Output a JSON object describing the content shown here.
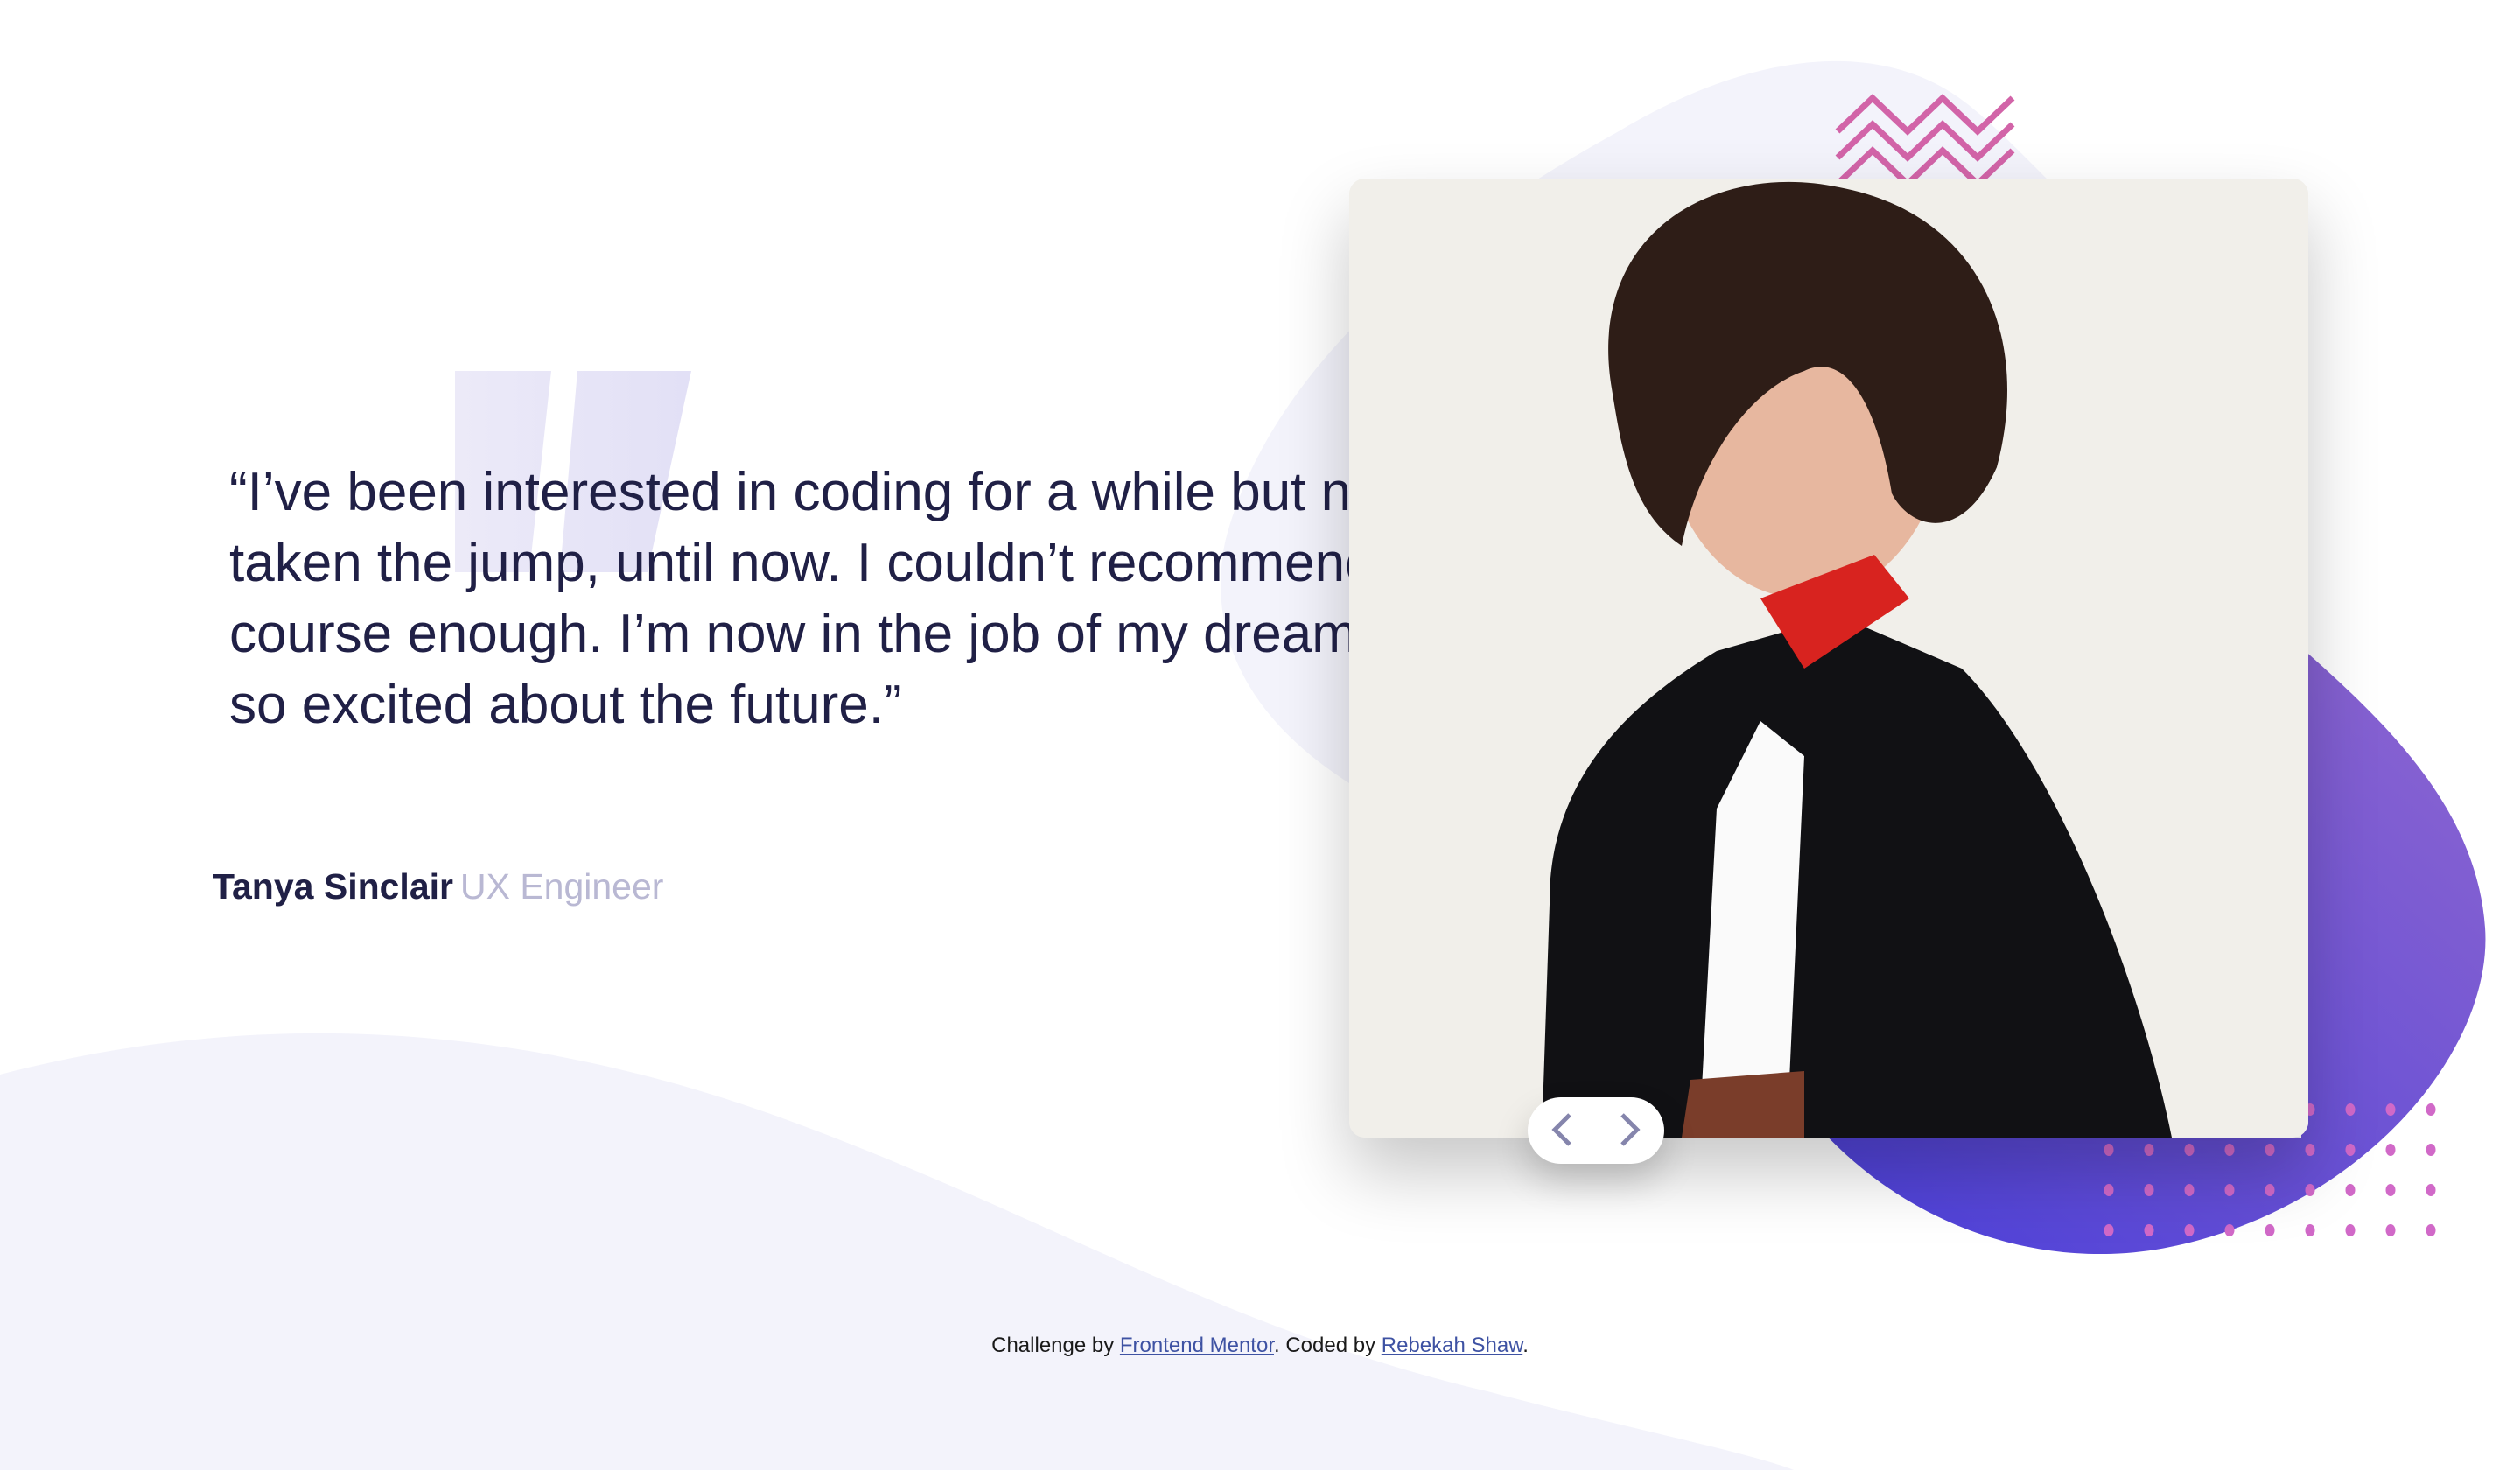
{
  "testimonial": {
    "quote": "“I’ve been interested in coding for a while but never taken the jump, until now. I couldn’t recommend this course enough. I’m now in the job of my dreams and so excited about the future.”",
    "name": "Tanya Sinclair",
    "role": "UX Engineer"
  },
  "slider": {
    "prev_icon": "chevron-left-icon",
    "next_icon": "chevron-right-icon"
  },
  "footer": {
    "prefix": "Challenge by ",
    "link1": "Frontend Mentor",
    "middle": ". Coded by ",
    "link2": "Rebekah Shaw",
    "suffix": "."
  },
  "colors": {
    "text_dark": "#202046",
    "text_muted": "#b9b8d3",
    "blob_start": "#4a3fd6",
    "blob_end": "#8c63d1",
    "accent_pink": "#d264c0",
    "light_bg": "#f3f3fb"
  }
}
